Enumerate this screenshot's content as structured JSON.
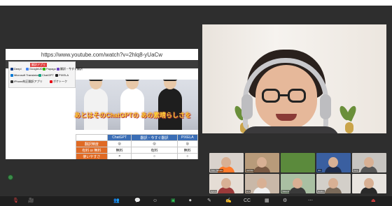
{
  "shared_screen": {
    "url": "https://www.youtube.com/watch?v=2hlq8-yUaCw",
    "logo_panel": {
      "tag": "翻訳アプリ",
      "items": [
        "Deepl",
        "GoogleUD",
        "Papago",
        "翻訳・今すぐ翻訳",
        "Microsoft Translator",
        "ChatGPT",
        "PIXELA",
        "iPhone純正翻訳アプリ",
        "ポケトーク"
      ]
    },
    "overlay_caption": "あとはそのChatGPTの あの素晴らしさを",
    "table": {
      "headers": [
        "",
        "ChatGPT",
        "翻訳・今すぐ翻訳",
        "PIXELA"
      ],
      "rows": [
        {
          "label": "翻訳精度",
          "cells": [
            "◎",
            "◎",
            "◎"
          ]
        },
        {
          "label": "有料 or 無料",
          "cells": [
            "無料",
            "有料",
            "無料"
          ]
        },
        {
          "label": "使いやすさ",
          "cells": [
            "×",
            "○",
            "○"
          ]
        }
      ]
    }
  },
  "gallery": {
    "tiles": [
      {
        "name": "Yoko Tanaka"
      },
      {
        "name": "sachiko"
      },
      {
        "name": ""
      },
      {
        "name": "Jim"
      },
      {
        "name": "Kenji"
      },
      {
        "name": "Ayumi"
      },
      {
        "name": "Emi"
      },
      {
        "name": "Takashi"
      },
      {
        "name": "Naoko"
      },
      {
        "name": ""
      }
    ]
  },
  "toolbar": {
    "mic_icon": "🎙",
    "video_icon": "🎥",
    "participants_icon": "👥",
    "chat_icon": "💬",
    "react_icon": "☺",
    "share_icon": "▣",
    "record_icon": "⏺",
    "apps_icon": "▦",
    "more_icon": "⋯",
    "whiteboard_icon": "✎",
    "notes_icon": "✍",
    "settings_icon": "⚙",
    "captions_icon": "CC",
    "end_icon": "⏏"
  },
  "colors": {
    "brand_red": "#e04040",
    "table_header": "#3a6db5",
    "table_row_label": "#e06a24",
    "caption_yellow": "#ffd23a",
    "toolbar_bg": "#1f1f1f"
  }
}
